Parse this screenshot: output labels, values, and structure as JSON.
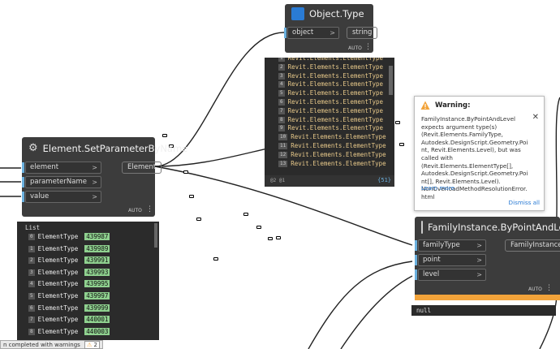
{
  "object_type_node": {
    "title": "Object.Type",
    "input_label": "object",
    "output_label": "string",
    "auto": "AUTO"
  },
  "element_types_preview": {
    "rows": [
      {
        "idx": "1",
        "text": "Revit.Elements.ElementType"
      },
      {
        "idx": "2",
        "text": "Revit.Elements.ElementType"
      },
      {
        "idx": "3",
        "text": "Revit.Elements.ElementType"
      },
      {
        "idx": "4",
        "text": "Revit.Elements.ElementType"
      },
      {
        "idx": "5",
        "text": "Revit.Elements.ElementType"
      },
      {
        "idx": "6",
        "text": "Revit.Elements.ElementType"
      },
      {
        "idx": "7",
        "text": "Revit.Elements.ElementType"
      },
      {
        "idx": "8",
        "text": "Revit.Elements.ElementType"
      },
      {
        "idx": "9",
        "text": "Revit.Elements.ElementType"
      },
      {
        "idx": "10",
        "text": "Revit.Elements.ElementType"
      },
      {
        "idx": "11",
        "text": "Revit.Elements.ElementType"
      },
      {
        "idx": "12",
        "text": "Revit.Elements.ElementType"
      },
      {
        "idx": "13",
        "text": "Revit.Elements.ElementType"
      }
    ],
    "footer_left": "@2 @1",
    "footer_right": "{51}"
  },
  "set_param_node": {
    "title": "Element.SetParameterByName",
    "inputs": [
      "element",
      "parameterName",
      "value"
    ],
    "output_label": "Element",
    "auto": "AUTO"
  },
  "list_preview": {
    "header": "List",
    "rows": [
      {
        "idx": "0",
        "label": "ElementType",
        "value": "439987"
      },
      {
        "idx": "1",
        "label": "ElementType",
        "value": "439989"
      },
      {
        "idx": "2",
        "label": "ElementType",
        "value": "439991"
      },
      {
        "idx": "3",
        "label": "ElementType",
        "value": "439993"
      },
      {
        "idx": "4",
        "label": "ElementType",
        "value": "439995"
      },
      {
        "idx": "5",
        "label": "ElementType",
        "value": "439997"
      },
      {
        "idx": "6",
        "label": "ElementType",
        "value": "439999"
      },
      {
        "idx": "7",
        "label": "ElementType",
        "value": "440001"
      },
      {
        "idx": "8",
        "label": "ElementType",
        "value": "440003"
      }
    ]
  },
  "warning": {
    "title": "Warning:",
    "message": "FamilyInstance.ByPointAndLevel expects argument type(s) (Revit.Elements.FamilyType, Autodesk.DesignScript.Geometry.Point, Revit.Elements.Level), but was called with (Revit.Elements.ElementType[], Autodesk.DesignScript.Geometry.Point[], Revit.Elements.Level). NonOverloadMethodResolutionError.html",
    "learn_more": "Learn more",
    "dismiss": "Dismiss all"
  },
  "family_node": {
    "title": "FamilyInstance.ByPointAndLevel",
    "inputs": [
      "familyType",
      "point",
      "level"
    ],
    "output_label": "FamilyInstance",
    "auto": "AUTO",
    "result": "null"
  },
  "status_bar": {
    "text": "n completed with warnings",
    "warning_count": "2"
  },
  "colors": {
    "node_bg": "#3c3c3c",
    "warning_bar": "#f2a33a",
    "port_accent": "#6ab0de",
    "link": "#2a7bd4"
  }
}
